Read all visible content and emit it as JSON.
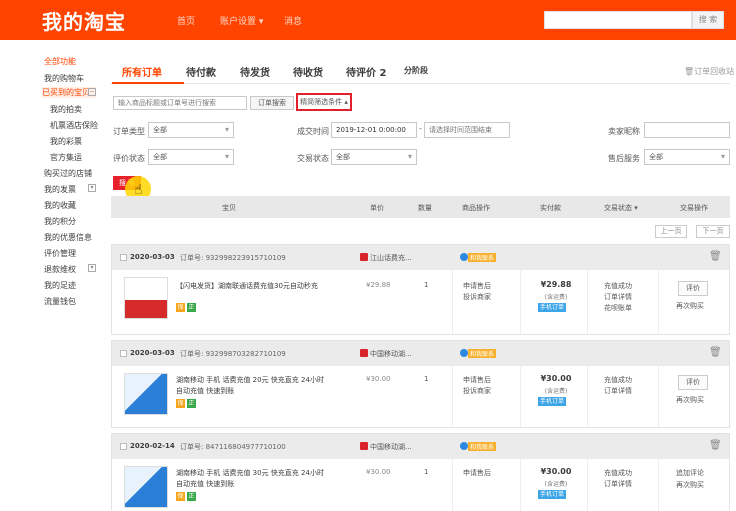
{
  "header": {
    "logo": "我的淘宝",
    "nav": [
      "首页",
      "账户设置 ▾",
      "消息"
    ],
    "search_button": "搜 索"
  },
  "sidebar": {
    "items": [
      {
        "label": "全部功能",
        "style": "orange"
      },
      {
        "label": "我的购物车",
        "style": ""
      },
      {
        "label": "已买到的宝贝",
        "style": "orange-hl"
      },
      {
        "label": "我的拍卖",
        "style": ""
      },
      {
        "label": "机票酒店保险",
        "style": ""
      },
      {
        "label": "我的彩票",
        "style": ""
      },
      {
        "label": "官方集运",
        "style": ""
      },
      {
        "label": "购买过的店铺",
        "style": ""
      },
      {
        "label": "我的发票",
        "style": ""
      },
      {
        "label": "我的收藏",
        "style": ""
      },
      {
        "label": "我的积分",
        "style": ""
      },
      {
        "label": "我的优惠信息",
        "style": ""
      },
      {
        "label": "评价管理",
        "style": ""
      },
      {
        "label": "退款维权",
        "style": ""
      },
      {
        "label": "我的足迹",
        "style": ""
      },
      {
        "label": "流量钱包",
        "style": ""
      }
    ]
  },
  "tabs": [
    {
      "label": "所有订单"
    },
    {
      "label": "待付款"
    },
    {
      "label": "待发货"
    },
    {
      "label": "待收货"
    },
    {
      "label": "待评价 2"
    },
    {
      "label": "分阶段"
    }
  ],
  "tab_recycle": "订单回收站",
  "search": {
    "placeholder": "输入商品标题或订单号进行搜索",
    "button": "订单搜索",
    "more": "精简筛选条件 ▴"
  },
  "filters": {
    "order_type_label": "订单类型",
    "order_type_value": "全部",
    "deal_time_label": "成交时间",
    "deal_time_start": "2019-12-01 0:00:00",
    "deal_time_end_placeholder": "请选择时间范围结束",
    "seller_label": "卖家昵称",
    "review_label": "评价状态",
    "review_value": "全部",
    "trade_status_label": "交易状态",
    "trade_status_value": "全部",
    "aftersale_label": "售后服务",
    "aftersale_value": "全部",
    "search_button": "搜 索"
  },
  "table_header": {
    "item": "宝贝",
    "price": "单价",
    "qty": "数量",
    "ops": "商品操作",
    "paid": "实付款",
    "status": "交易状态",
    "actions": "交易操作"
  },
  "pager": {
    "prev": "上一页",
    "next": "下一页"
  },
  "orders": [
    {
      "date": "2020-03-03",
      "number": "订单号: 932998223915710109",
      "shop": "江山话费充...",
      "contact": "和我联系",
      "title": "【闪电发货】湖南联通话费充值30元自动秒充",
      "price": "¥29.88",
      "qty": "1",
      "ops": [
        "申请售后",
        "投诉商家"
      ],
      "total": "¥29.88",
      "total_sub": "(含运费)",
      "mobile": "手机订单",
      "status": [
        "充值成功",
        "订单详情",
        "花呗账单"
      ],
      "action_btn": "评价",
      "rebuy": "再次购买",
      "thumb_color": "#d52b2b"
    },
    {
      "date": "2020-03-03",
      "number": "订单号: 932998703282710109",
      "shop": "中国移动湖...",
      "contact": "和我联系",
      "title": "湖南移动 手机 话费充值 20元 快充直充 24小时自动充值 快速到账",
      "price": "¥30.00",
      "qty": "1",
      "ops": [
        "申请售后",
        "投诉商家"
      ],
      "total": "¥30.00",
      "total_sub": "(含运费)",
      "mobile": "手机订单",
      "status": [
        "充值成功",
        "订单详情"
      ],
      "action_btn": "评价",
      "rebuy": "再次购买",
      "thumb_color": "#2c7fd6"
    },
    {
      "date": "2020-02-14",
      "number": "订单号: 847116804977710100",
      "shop": "中国移动湖...",
      "contact": "和我联系",
      "title": "湖南移动 手机 话费充值 30元 快充直充 24小时自动充值 快速到账",
      "price": "¥30.00",
      "qty": "1",
      "ops": [
        "申请售后"
      ],
      "total": "¥30.00",
      "total_sub": "(含运费)",
      "mobile": "手机订单",
      "status": [
        "充值成功",
        "订单详情"
      ],
      "action_btn": "追加评论",
      "rebuy": "再次购买",
      "thumb_color": "#2c7fd6"
    }
  ]
}
